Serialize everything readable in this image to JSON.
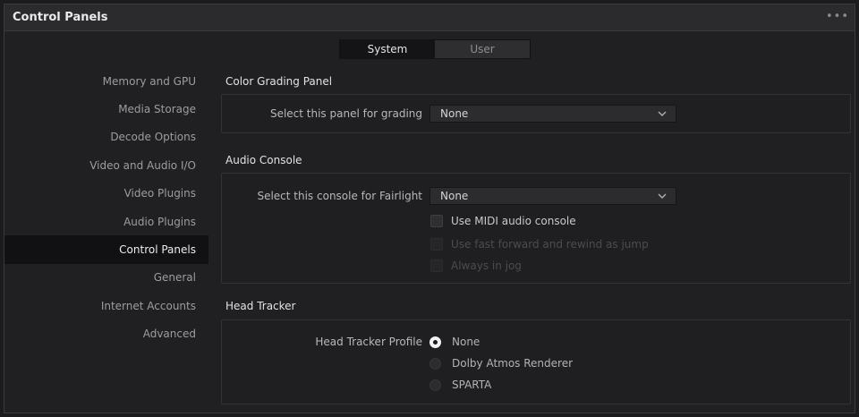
{
  "window": {
    "title": "Control Panels",
    "more_icon": "ellipsis-icon",
    "more_text": "•••"
  },
  "tabs": [
    {
      "label": "System",
      "active": true
    },
    {
      "label": "User",
      "active": false
    }
  ],
  "sidebar": {
    "items": [
      {
        "label": "Memory and GPU",
        "active": false
      },
      {
        "label": "Media Storage",
        "active": false
      },
      {
        "label": "Decode Options",
        "active": false
      },
      {
        "label": "Video and Audio I/O",
        "active": false
      },
      {
        "label": "Video Plugins",
        "active": false
      },
      {
        "label": "Audio Plugins",
        "active": false
      },
      {
        "label": "Control Panels",
        "active": true
      },
      {
        "label": "General",
        "active": false
      },
      {
        "label": "Internet Accounts",
        "active": false
      },
      {
        "label": "Advanced",
        "active": false
      }
    ]
  },
  "color_grading": {
    "title": "Color Grading Panel",
    "select_label": "Select this panel for grading",
    "select_value": "None"
  },
  "audio_console": {
    "title": "Audio Console",
    "select_label": "Select this console for Fairlight",
    "select_value": "None",
    "checkboxes": [
      {
        "label": "Use MIDI audio console",
        "checked": false,
        "enabled": true
      },
      {
        "label": "Use fast forward and rewind as jump",
        "checked": false,
        "enabled": false
      },
      {
        "label": "Always in jog",
        "checked": false,
        "enabled": false
      }
    ]
  },
  "head_tracker": {
    "title": "Head Tracker",
    "profile_label": "Head Tracker Profile",
    "options": [
      {
        "label": "None",
        "selected": true
      },
      {
        "label": "Dolby Atmos Renderer",
        "selected": false
      },
      {
        "label": "SPARTA",
        "selected": false
      }
    ]
  }
}
